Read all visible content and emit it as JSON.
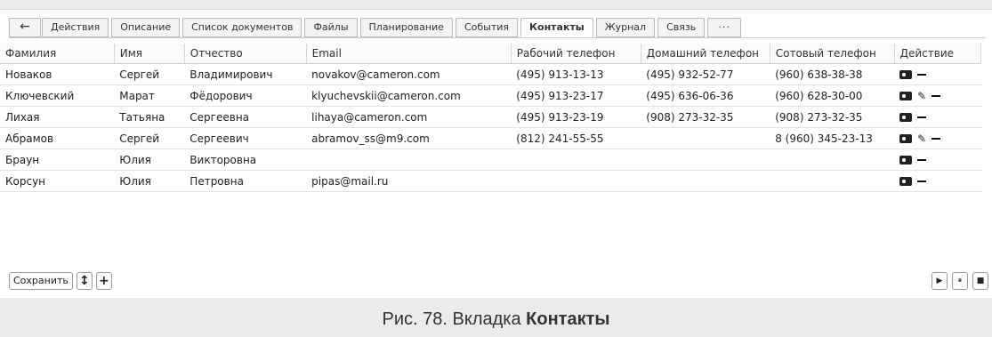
{
  "tabs": [
    {
      "label": "Действия"
    },
    {
      "label": "Описание"
    },
    {
      "label": "Список документов"
    },
    {
      "label": "Файлы"
    },
    {
      "label": "Планирование"
    },
    {
      "label": "События"
    },
    {
      "label": "Контакты"
    },
    {
      "label": "Журнал"
    },
    {
      "label": "Связь"
    },
    {
      "label": "···"
    }
  ],
  "table": {
    "headers": [
      "Фамилия",
      "Имя",
      "Отчество",
      "Email",
      "Рабочий телефон",
      "Домашний телефон",
      "Сотовый телефон",
      "Действие"
    ],
    "rows": [
      {
        "cells": [
          "Новаков",
          "Сергей",
          "Владимирович",
          "novakov@cameron.com",
          "(495) 913-13-13",
          "(495) 932-52-77",
          "(960) 638-38-38"
        ],
        "edit": false
      },
      {
        "cells": [
          "Ключевский",
          "Марат",
          "Фёдорович",
          "klyuchevskii@cameron.com",
          "(495) 913-23-17",
          "(495) 636-06-36",
          "(960) 628-30-00"
        ],
        "edit": true
      },
      {
        "cells": [
          "Лихая",
          "Татьяна",
          "Сергеевна",
          "lihaya@cameron.com",
          "(495) 913-23-19",
          "(908) 273-32-35",
          "(908) 273-32-35"
        ],
        "edit": false
      },
      {
        "cells": [
          "Абрамов",
          "Сергей",
          "Сергеевич",
          "abramov_ss@m9.com",
          "(812) 241-55-55",
          "",
          "8 (960) 345-23-13"
        ],
        "edit": true
      },
      {
        "cells": [
          "Браун",
          "Юлия",
          "Викторовна",
          "",
          "",
          "",
          ""
        ],
        "edit": false
      },
      {
        "cells": [
          "Корсун",
          "Юлия",
          "Петровна",
          "pipas@mail.ru",
          "",
          "",
          ""
        ],
        "edit": false
      }
    ]
  },
  "bottom": {
    "save_label": "Сохранить",
    "sort_label": "↕",
    "add_label": "+"
  },
  "controls": {
    "play": "▶",
    "pause": "⏸",
    "stop": "■"
  },
  "caption": {
    "prefix": "Рис. 78. Вкладка ",
    "bold": "Контакты"
  }
}
